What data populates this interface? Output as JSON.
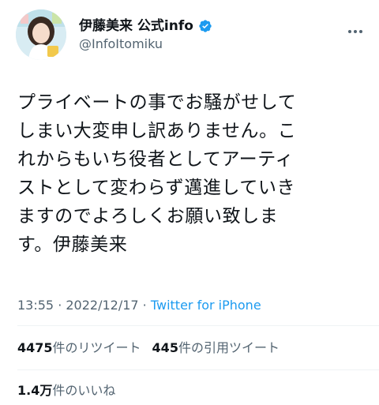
{
  "account": {
    "display_name": "伊藤美来 公式info",
    "handle": "@InfoItomiku"
  },
  "tweet": {
    "text": "プライベートの事でお騒がせして\nしまい大変申し訳ありません。こ\nれからもいち役者としてアーティ\nストとして変わらず邁進していき\nますのでよろしくお願い致しま\nす。伊藤美来",
    "time": "13:55",
    "separator1": " · ",
    "date": "2022/12/17",
    "separator2": " · ",
    "source": "Twitter for iPhone"
  },
  "stats": {
    "retweets_count": "4475",
    "retweets_label": "件のリツイート",
    "quotes_count": "445",
    "quotes_label": "件の引用ツイート",
    "likes_count": "1.4万",
    "likes_label": "件のいいね"
  },
  "colors": {
    "accent": "#1d9bf0",
    "secondary_text": "#536471",
    "divider": "#eff3f4"
  },
  "icons": {
    "verified": "verified-badge-icon",
    "more": "more-options-icon"
  }
}
